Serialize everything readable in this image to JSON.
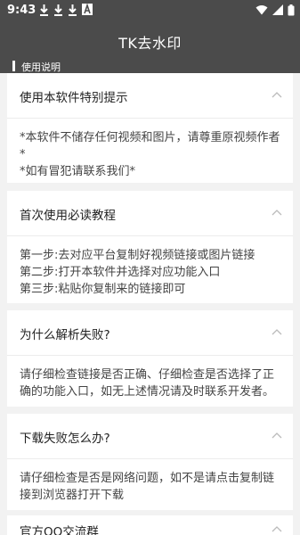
{
  "status_bar": {
    "time": "9:43"
  },
  "app": {
    "title": "TK去水印"
  },
  "section": {
    "label": "使用说明"
  },
  "faq": [
    {
      "title": "使用本软件特别提示",
      "lines": [
        "*本软件不储存任何视频和图片，请尊重原视频作者*",
        "*如有冒犯请联系我们*"
      ]
    },
    {
      "title": "首次使用必读教程",
      "lines": [
        "第一步:去对应平台复制好视频链接或图片链接",
        "第二步:打开本软件并选择对应功能入口",
        "第三步:粘贴你复制来的链接即可"
      ]
    },
    {
      "title": "为什么解析失败?",
      "lines": [
        "请仔细检查链接是否正确、仔细检查是否选择了正确的功能入口，如无上述情况请及时联系开发者。"
      ]
    },
    {
      "title": "下载失败怎么办?",
      "lines": [
        "请仔细检查是否是网络问题，如不是请点击复制链接到浏览器打开下载"
      ]
    },
    {
      "title": "官方QQ交流群",
      "lines": []
    }
  ],
  "icons": [
    "download-icon",
    "download-icon",
    "download-icon",
    "font-icon",
    "wifi-icon",
    "signal-icon",
    "battery-icon",
    "chevron-up-icon"
  ]
}
